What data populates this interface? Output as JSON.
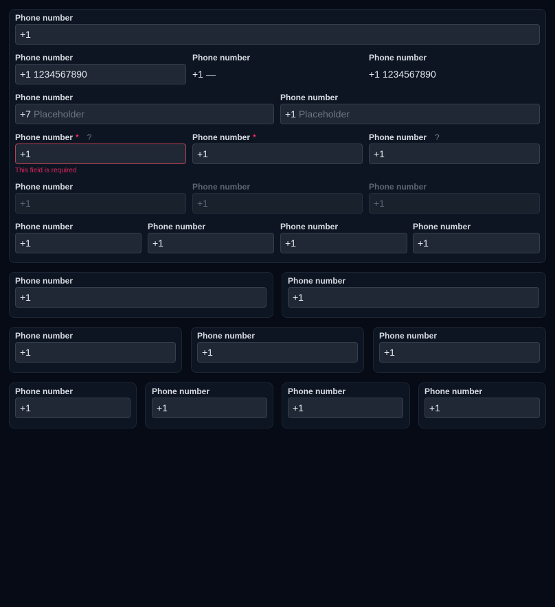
{
  "label": "Phone number",
  "code_us": "+1",
  "code_ru": "+7",
  "sample_number": "1234567890",
  "empty_value": "—",
  "placeholder": "Placeholder",
  "required_mark": "*",
  "help_mark": "?",
  "error_message": "This field is required"
}
